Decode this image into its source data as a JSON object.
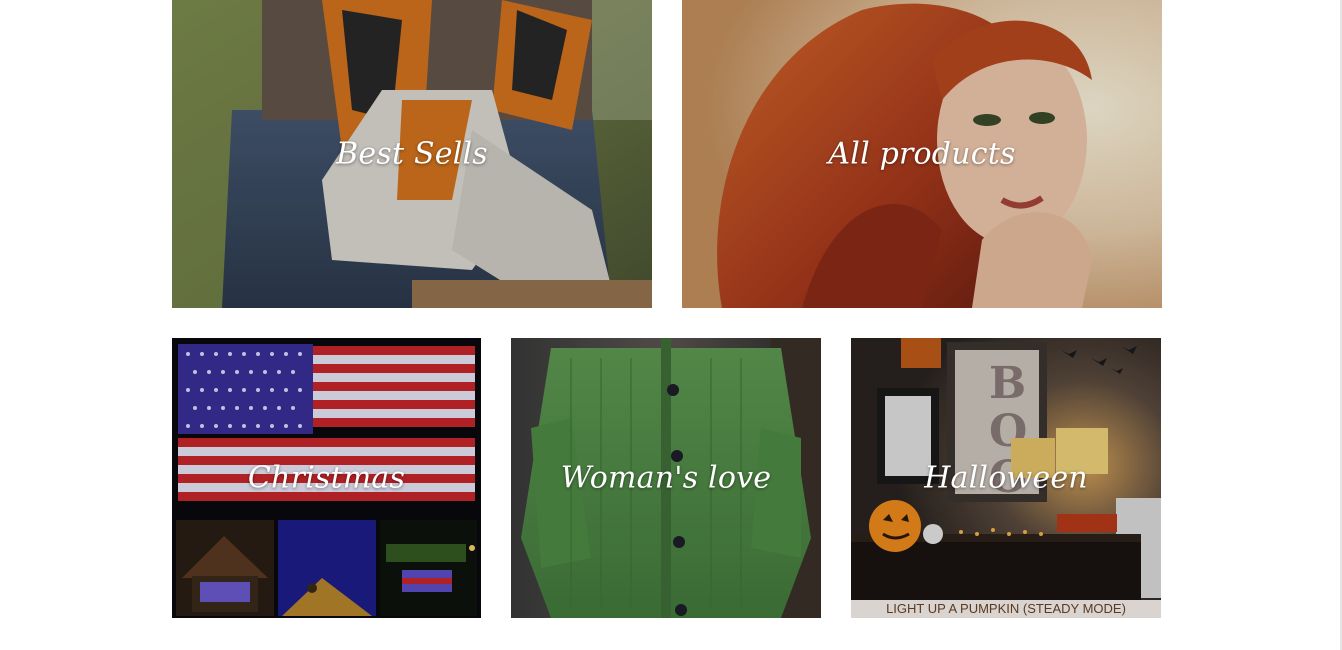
{
  "categories": {
    "best_sells": {
      "label": "Best Sells",
      "colors": {
        "accent": "#e07a1f",
        "background": "#6b7a4a"
      }
    },
    "all_products": {
      "label": "All products",
      "colors": {
        "accent": "#b23a1a",
        "background": "#e8c8a8"
      }
    },
    "christmas": {
      "label": "Christmas",
      "colors": {
        "accent": "#c9262b",
        "background": "#0a0a14"
      }
    },
    "womans_love": {
      "label": "Woman's love",
      "colors": {
        "accent": "#4e8b45",
        "background": "#2a2a2a"
      }
    },
    "halloween": {
      "label": "Halloween",
      "caption": "LIGHT UP A PUMPKIN (STEADY MODE)",
      "colors": {
        "accent": "#f08a1c",
        "background": "#3a3330"
      }
    }
  }
}
